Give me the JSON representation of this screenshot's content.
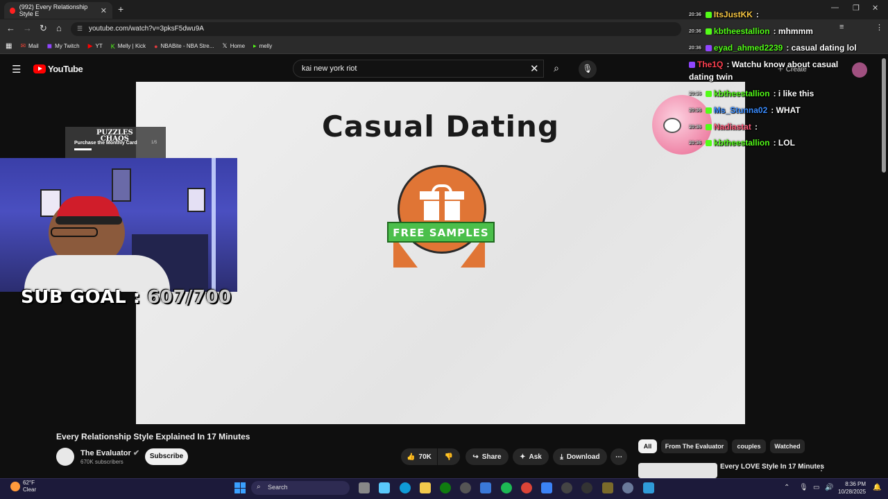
{
  "browser": {
    "tab_title": "(992) Every Relationship Style E",
    "url": "youtube.com/watch?v=3pksF5dwu9A",
    "bookmarks": [
      {
        "label": "Mail",
        "icon": "mail-icon"
      },
      {
        "label": "My Twitch",
        "icon": "twitch-icon"
      },
      {
        "label": "YT",
        "icon": "youtube-icon"
      },
      {
        "label": "Melly | Kick",
        "icon": "kick-icon"
      },
      {
        "label": "NBABite - NBA Stre...",
        "icon": "nba-icon"
      },
      {
        "label": "Home",
        "icon": "x-icon"
      },
      {
        "label": "melly",
        "icon": "bookmark-icon"
      }
    ]
  },
  "youtube": {
    "logo": "YouTube",
    "search_value": "kai new york riot",
    "create_label": "Create"
  },
  "video": {
    "slide_title": "Casual Dating",
    "badge_text": "FREE SAMPLES",
    "title": "Every Relationship Style Explained In 17 Minutes",
    "channel": "The Evaluator",
    "subscribers": "670K subscribers",
    "subscribe_label": "Subscribe",
    "likes": "70K",
    "share_label": "Share",
    "ask_label": "Ask",
    "download_label": "Download"
  },
  "promo": {
    "logo_line1": "PUZZLES",
    "logo_line2": "CHAOS",
    "text": "Purchase the Monthly Card",
    "page": "1/5"
  },
  "stream": {
    "sub_goal_label": "SUB GOAL :",
    "sub_goal_count": "607/700"
  },
  "chat": [
    {
      "ts": "20:36",
      "user": "ItsJustKK",
      "text": ":",
      "user_color": "#f5c542",
      "platform": "k"
    },
    {
      "ts": "20:36",
      "user": "kbtheestallion",
      "text": ": mhmmm",
      "user_color": "#53fc18",
      "platform": "k"
    },
    {
      "ts": "20:36",
      "user": "eyad_ahmed2239",
      "text": ": casual dating lol",
      "user_color": "#53fc18",
      "platform": "t"
    },
    {
      "ts": "",
      "user": "The1Q",
      "text": ": Watchu know about casual",
      "user_color": "#ff4050",
      "platform": "t"
    },
    {
      "ts": "",
      "user": "",
      "text": "dating twin",
      "user_color": "#ffffff",
      "platform": ""
    },
    {
      "ts": "20:36",
      "user": "kbtheestallion",
      "text": ": i like this",
      "user_color": "#53fc18",
      "platform": "k"
    },
    {
      "ts": "20:36",
      "user": "Ms_Stunna02",
      "text": ": WHAT",
      "user_color": "#3a8cff",
      "platform": "k"
    },
    {
      "ts": "20:36",
      "user": "Nadiastat",
      "text": ":",
      "user_color": "#ff5a7a",
      "platform": "k"
    },
    {
      "ts": "20:36",
      "user": "kbtheestallion",
      "text": ": LOL",
      "user_color": "#53fc18",
      "platform": "k"
    }
  ],
  "chips": [
    "All",
    "From The Evaluator",
    "couples",
    "Watched"
  ],
  "related": {
    "title": "Every LOVE Style In 17 Minutes"
  },
  "taskbar": {
    "temp": "62°F",
    "condition": "Clear",
    "search_label": "Search",
    "time": "8:36 PM",
    "date": "10/28/2025"
  }
}
